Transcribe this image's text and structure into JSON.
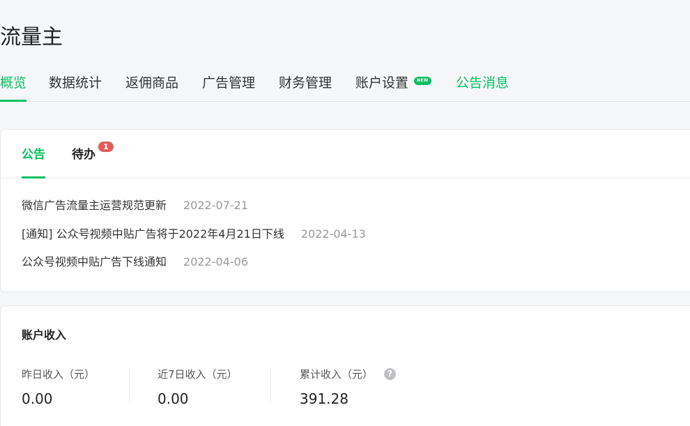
{
  "header": {
    "title": "流量主"
  },
  "nav": {
    "items": [
      {
        "label": "概览"
      },
      {
        "label": "数据统计"
      },
      {
        "label": "返佣商品"
      },
      {
        "label": "广告管理"
      },
      {
        "label": "财务管理"
      },
      {
        "label": "账户设置",
        "badge": "NEW"
      },
      {
        "label": "公告消息"
      }
    ]
  },
  "notice_card": {
    "tabs": [
      {
        "label": "公告"
      },
      {
        "label": "待办",
        "badge": "1"
      }
    ],
    "items": [
      {
        "title": "微信广告流量主运营规范更新",
        "date": "2022-07-21"
      },
      {
        "title": "[通知] 公众号视频中贴广告将于2022年4月21日下线",
        "date": "2022-04-13"
      },
      {
        "title": "公众号视频中贴广告下线通知",
        "date": "2022-04-06"
      }
    ]
  },
  "income_card": {
    "title": "账户收入",
    "stats": [
      {
        "label": "昨日收入（元）",
        "value": "0.00"
      },
      {
        "label": "近7日收入（元）",
        "value": "0.00"
      },
      {
        "label": "累计收入（元）",
        "value": "391.28"
      }
    ],
    "help_icon_glyph": "?"
  },
  "colors": {
    "accent": "#07c160",
    "badge_red": "#e45b58",
    "muted_text": "#999999"
  }
}
